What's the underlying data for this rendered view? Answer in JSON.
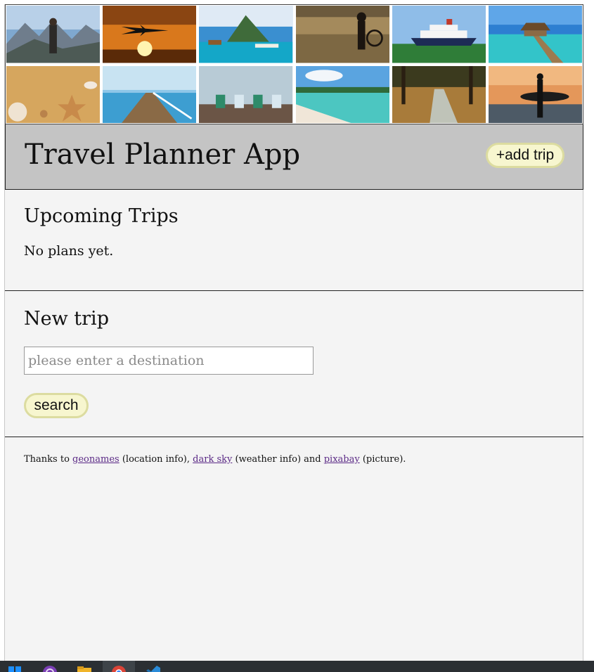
{
  "header": {
    "title": "Travel Planner App",
    "add_trip_label": "+add trip"
  },
  "gallery": {
    "photos": [
      "hiker-mountains-photo",
      "airplane-sunset-photo",
      "overwater-bungalows-photo",
      "beach-silhouette-photo",
      "cruise-ship-photo",
      "pier-bungalow-photo",
      "seashells-sand-photo",
      "wooden-pier-photo",
      "beach-chairs-photo",
      "tropical-shore-photo",
      "boardwalk-path-photo",
      "surfer-silhouette-photo"
    ]
  },
  "upcoming": {
    "heading": "Upcoming Trips",
    "empty_text": "No plans yet."
  },
  "new_trip": {
    "heading": "New trip",
    "destination_placeholder": "please enter a destination",
    "search_label": "search"
  },
  "footer": {
    "text_1": "Thanks to ",
    "link_1": "geonames",
    "text_2": " (location info), ",
    "link_2": "dark sky",
    "text_3": " (weather info) and ",
    "link_3": "pixabay",
    "text_4": " (picture)."
  },
  "colors": {
    "header_bg": "#c4c4c4",
    "page_bg": "#f4f4f4",
    "button_bg": "#f7f6cf",
    "button_border": "#dcdca0",
    "link": "#5b2a86",
    "taskbar": "#2b2f33"
  },
  "taskbar": {
    "icons": [
      "windows-start-icon",
      "visual-studio-icon",
      "file-explorer-icon",
      "chrome-icon",
      "vscode-icon"
    ]
  }
}
